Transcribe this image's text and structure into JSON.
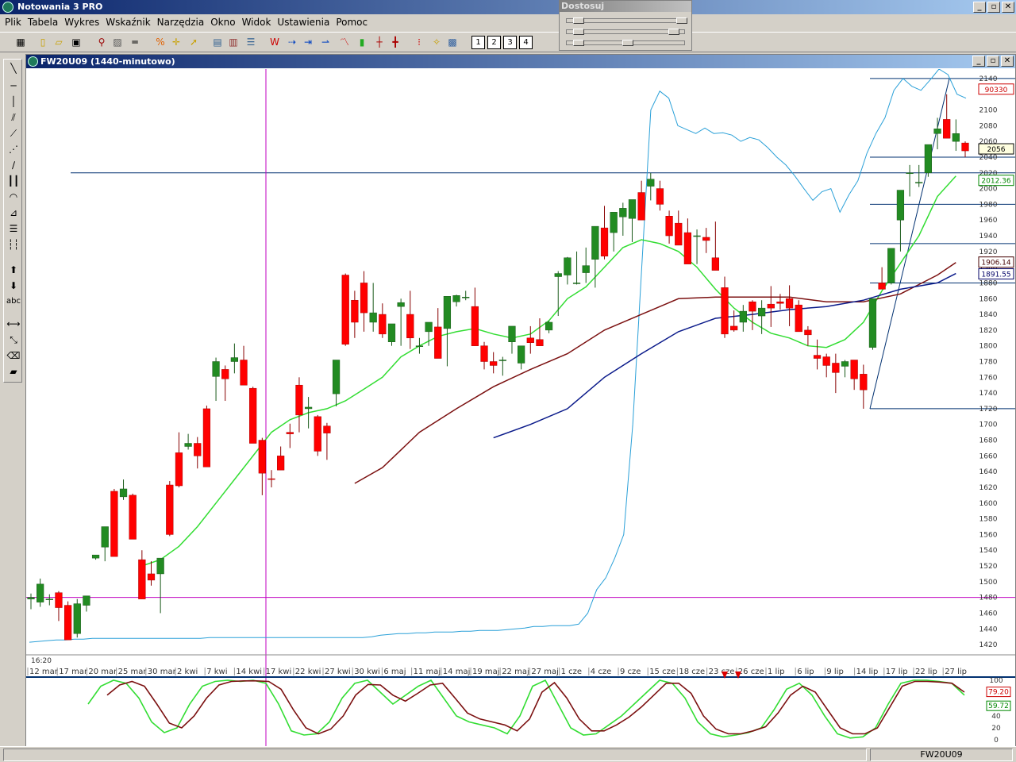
{
  "app": {
    "title": "Notowania 3 PRO"
  },
  "window_buttons": [
    "_",
    "▫",
    "✕"
  ],
  "menu": [
    "Plik",
    "Tabela",
    "Wykres",
    "Wskaźnik",
    "Narzędzia",
    "Okno",
    "Widok",
    "Ustawienia",
    "Pomoc"
  ],
  "toolbar": {
    "tab_numbers": [
      "1",
      "2",
      "3",
      "4"
    ]
  },
  "dostosuj": {
    "title": "Dostosuj"
  },
  "chart_window": {
    "title": "FW20U09 (1440-minutowo)"
  },
  "status": {
    "symbol": "FW20U09"
  },
  "chart_data": {
    "type": "candlestick",
    "symbol": "FW20U09",
    "interval": "1440-minutowo",
    "time_label": "16:20",
    "ylim": [
      1410,
      2150
    ],
    "y_ticks": [
      1420,
      1440,
      1460,
      1480,
      1500,
      1520,
      1540,
      1560,
      1580,
      1600,
      1620,
      1640,
      1660,
      1680,
      1700,
      1720,
      1740,
      1760,
      1780,
      1800,
      1820,
      1840,
      1860,
      1880,
      1900,
      1920,
      1940,
      1960,
      1980,
      2000,
      2020,
      2040,
      2060,
      2080,
      2100,
      2140
    ],
    "x_labels": [
      "12 mar",
      "17 mar",
      "20 mar",
      "25 mar",
      "30 mar",
      "2 kwi",
      "7 kwi",
      "14 kwi",
      "17 kwi",
      "22 kwi",
      "27 kwi",
      "30 kwi",
      "6 maj",
      "11 maj",
      "14 maj",
      "19 maj",
      "22 maj",
      "27 maj",
      "1 cze",
      "4 cze",
      "9 cze",
      "15 cze",
      "18 cze",
      "23 cze",
      "26 cze",
      "1 lip",
      "6 lip",
      "9 lip",
      "14 lip",
      "17 lip",
      "22 lip",
      "27 lip"
    ],
    "candles": [
      [
        1478,
        1485,
        1465,
        1480
      ],
      [
        1474,
        1504,
        1468,
        1497
      ],
      [
        1478,
        1484,
        1470,
        1478
      ],
      [
        1486,
        1488,
        1450,
        1467
      ],
      [
        1470,
        1475,
        1426,
        1426
      ],
      [
        1434,
        1478,
        1429,
        1472
      ],
      [
        1470,
        1480,
        1462,
        1482
      ],
      [
        1530,
        1534,
        1528,
        1534
      ],
      [
        1544,
        1564,
        1526,
        1570
      ],
      [
        1615,
        1618,
        1534,
        1532
      ],
      [
        1608,
        1630,
        1604,
        1618
      ],
      [
        1610,
        1612,
        1568,
        1554
      ],
      [
        1528,
        1540,
        1478,
        1478
      ],
      [
        1510,
        1526,
        1495,
        1502
      ],
      [
        1510,
        1528,
        1460,
        1530
      ],
      [
        1623,
        1628,
        1558,
        1560
      ],
      [
        1664,
        1690,
        1620,
        1622
      ],
      [
        1672,
        1688,
        1668,
        1676
      ],
      [
        1676,
        1684,
        1644,
        1660
      ],
      [
        1720,
        1724,
        1648,
        1646
      ],
      [
        1761,
        1785,
        1730,
        1780
      ],
      [
        1770,
        1775,
        1730,
        1758
      ],
      [
        1780,
        1803,
        1765,
        1785
      ],
      [
        1782,
        1800,
        1758,
        1750
      ],
      [
        1746,
        1748,
        1678,
        1676
      ],
      [
        1680,
        1683,
        1610,
        1638
      ],
      [
        1631,
        1642,
        1620,
        1630
      ],
      [
        1660,
        1672,
        1642,
        1642
      ],
      [
        1690,
        1701,
        1670,
        1688
      ],
      [
        1750,
        1760,
        1690,
        1712
      ],
      [
        1720,
        1735,
        1695,
        1722
      ],
      [
        1710,
        1712,
        1660,
        1666
      ],
      [
        1698,
        1702,
        1655,
        1689
      ],
      [
        1739,
        1745,
        1723,
        1782
      ],
      [
        1890,
        1892,
        1800,
        1802
      ],
      [
        1858,
        1870,
        1810,
        1830
      ],
      [
        1880,
        1895,
        1818,
        1842
      ],
      [
        1830,
        1880,
        1818,
        1842
      ],
      [
        1840,
        1854,
        1810,
        1815
      ],
      [
        1805,
        1808,
        1800,
        1828
      ],
      [
        1850,
        1860,
        1800,
        1855
      ],
      [
        1840,
        1870,
        1796,
        1810
      ],
      [
        1800,
        1810,
        1790,
        1800
      ],
      [
        1818,
        1823,
        1800,
        1830
      ],
      [
        1824,
        1848,
        1786,
        1784
      ],
      [
        1822,
        1860,
        1774,
        1863
      ],
      [
        1856,
        1865,
        1850,
        1864
      ],
      [
        1862,
        1870,
        1858,
        1862
      ],
      [
        1850,
        1874,
        1800,
        1800
      ],
      [
        1800,
        1805,
        1770,
        1780
      ],
      [
        1780,
        1792,
        1765,
        1775
      ],
      [
        1782,
        1786,
        1762,
        1782
      ],
      [
        1805,
        1808,
        1790,
        1825
      ],
      [
        1778,
        1782,
        1770,
        1800
      ],
      [
        1810,
        1825,
        1790,
        1804
      ],
      [
        1808,
        1835,
        1800,
        1800
      ],
      [
        1820,
        1832,
        1816,
        1830
      ],
      [
        1888,
        1895,
        1838,
        1892
      ],
      [
        1890,
        1913,
        1878,
        1912
      ],
      [
        1880,
        1920,
        1878,
        1880
      ],
      [
        1893,
        1925,
        1880,
        1902
      ],
      [
        1910,
        1940,
        1874,
        1952
      ],
      [
        1950,
        1978,
        1910,
        1914
      ],
      [
        1944,
        1966,
        1920,
        1970
      ],
      [
        1964,
        1982,
        1940,
        1975
      ],
      [
        1962,
        1980,
        1932,
        1986
      ],
      [
        1995,
        2010,
        1960,
        1960
      ],
      [
        2003,
        2020,
        1985,
        2012
      ],
      [
        2000,
        2010,
        1972,
        1980
      ],
      [
        1965,
        1972,
        1930,
        1940
      ],
      [
        1956,
        1972,
        1928,
        1928
      ],
      [
        1944,
        1962,
        1928,
        1904
      ],
      [
        1940,
        1948,
        1904,
        1940
      ],
      [
        1938,
        1950,
        1918,
        1934
      ],
      [
        1912,
        1958,
        1906,
        1896
      ],
      [
        1874,
        1888,
        1810,
        1815
      ],
      [
        1825,
        1845,
        1818,
        1820
      ],
      [
        1830,
        1852,
        1818,
        1844
      ],
      [
        1856,
        1858,
        1820,
        1844
      ],
      [
        1838,
        1858,
        1815,
        1848
      ],
      [
        1853,
        1876,
        1824,
        1848
      ],
      [
        1856,
        1866,
        1846,
        1854
      ],
      [
        1860,
        1877,
        1825,
        1848
      ],
      [
        1852,
        1858,
        1835,
        1818
      ],
      [
        1820,
        1825,
        1800,
        1814
      ],
      [
        1788,
        1808,
        1770,
        1784
      ],
      [
        1786,
        1790,
        1760,
        1775
      ],
      [
        1778,
        1790,
        1740,
        1766
      ],
      [
        1774,
        1782,
        1760,
        1780
      ],
      [
        1782,
        1782,
        1744,
        1758
      ],
      [
        1764,
        1776,
        1720,
        1744
      ],
      [
        1798,
        1860,
        1795,
        1860
      ],
      [
        1880,
        1900,
        1876,
        1872
      ],
      [
        1880,
        1910,
        1878,
        1924
      ],
      [
        1960,
        1990,
        1920,
        1998
      ],
      [
        2020,
        2030,
        1990,
        2020
      ],
      [
        2008,
        2030,
        2002,
        2008
      ],
      [
        2020,
        2050,
        2015,
        2056
      ],
      [
        2070,
        2090,
        2050,
        2076
      ],
      [
        2088,
        2120,
        2066,
        2064
      ],
      [
        2060,
        2088,
        2048,
        2070
      ],
      [
        2058,
        2060,
        2040,
        2048
      ]
    ],
    "indicators": {
      "price_labels": [
        "90330",
        "2056",
        "2012.36",
        "1906.14",
        "1891.55"
      ],
      "oscillator_labels": [
        "79.20",
        "59.72"
      ],
      "oscillator_ticks": [
        "100",
        "80",
        "60",
        "40",
        "20",
        "0"
      ]
    },
    "colors": {
      "up": "#228b22",
      "down": "#ff0000",
      "ma_fast": "#33dd33",
      "ma_mid": "#7b1010",
      "ma_slow": "#0a1a8a",
      "volume_line": "#2aa0d8",
      "hline": "#003070",
      "cursor": "#c000c0"
    }
  }
}
